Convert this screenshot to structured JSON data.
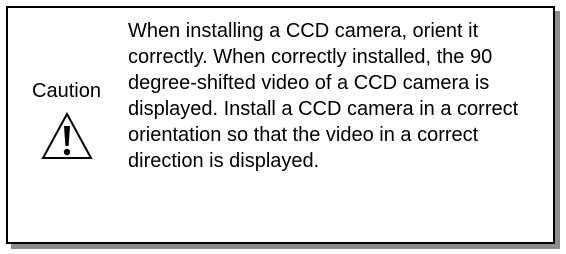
{
  "notice": {
    "label": "Caution",
    "icon": "warning-triangle-icon",
    "message": "When installing a CCD camera, orient it correctly. When correctly installed, the 90 degree-shifted video of a CCD camera is displayed. Install a CCD camera in a correct orientation so that the video in a correct direction is displayed."
  }
}
